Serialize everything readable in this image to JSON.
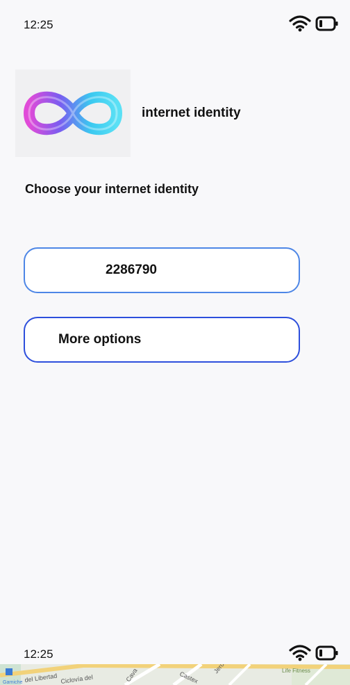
{
  "status_bar_top": {
    "time": "12:25",
    "icons": [
      "wifi-icon",
      "battery-icon"
    ]
  },
  "app_header": {
    "logo_icon": "infinity-logo-icon",
    "name": "internet identity"
  },
  "page": {
    "title": "Choose your internet identity"
  },
  "buttons": {
    "identity_label": "2286790",
    "more_options_label": "More options"
  },
  "status_bar_bottom": {
    "time": "12:25",
    "icons": [
      "wifi-icon",
      "battery-icon"
    ]
  },
  "map_strip": {
    "labels": [
      "del Libertad",
      "Ciclovía del",
      "Cava",
      "Castex",
      "Jerónimo",
      "Life Fitness",
      "Garniche"
    ]
  },
  "colors": {
    "identity_button_border": "#4d86e6",
    "more_options_button_border": "#2d4fdc",
    "logo_gradient": [
      "#3ac8f0",
      "#7a5cf0",
      "#e04bd8"
    ]
  }
}
